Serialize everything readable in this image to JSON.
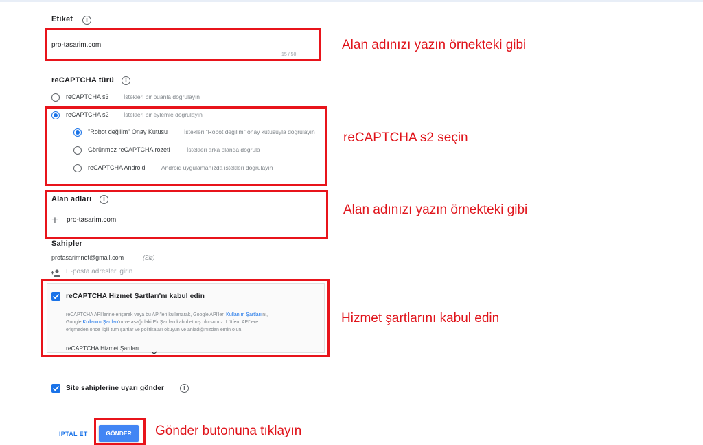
{
  "label_section": {
    "title": "Etiket",
    "value": "pro-tasarim.com",
    "counter": "15 / 50"
  },
  "recaptcha_type": {
    "title": "reCAPTCHA türü",
    "options": [
      {
        "label": "reCAPTCHA s3",
        "hint": "İstekleri bir puanla doğrulayın"
      },
      {
        "label": "reCAPTCHA s2",
        "hint": "İstekleri bir eylemle doğrulayın"
      }
    ],
    "sub_options": [
      {
        "label": "\"Robot değilim\" Onay Kutusu",
        "hint": "İstekleri \"Robot değilim\" onay kutusuyla doğrulayın"
      },
      {
        "label": "Görünmez reCAPTCHA rozeti",
        "hint": "İstekleri arka planda doğrula"
      },
      {
        "label": "reCAPTCHA Android",
        "hint": "Android uygulamanızda istekleri doğrulayın"
      }
    ]
  },
  "domains": {
    "title": "Alan adları",
    "value": "pro-tasarim.com"
  },
  "owners": {
    "title": "Sahipler",
    "email": "protasarimnet@gmail.com",
    "you_tag": "(Siz)",
    "placeholder": "E-posta adresleri girin"
  },
  "terms": {
    "title": "reCAPTCHA Hizmet Şartları'nı kabul edin",
    "body_1": "reCAPTCHA API'lerine erişerek veya bu API'leri kullanarak, Google API'leri ",
    "link_1": "Kullanım Şartları",
    "body_2": "'nı,",
    "body_3": "Google ",
    "link_2": "Kullanım Şartları",
    "body_4": "'nı ve aşağıdaki Ek Şartları kabul etmiş olursunuz. Lütfen, API'lere",
    "body_5": "erişmeden önce ilgili tüm şartlar ve politikaları okuyun ve anladığınızdan emin olun.",
    "dropdown": "reCAPTCHA Hizmet Şartları"
  },
  "alerts": {
    "label": "Site sahiplerine uyarı gönder"
  },
  "buttons": {
    "cancel": "İPTAL ET",
    "submit": "GÖNDER"
  },
  "annotations": {
    "a1": "Alan adınızı yazın örnekteki gibi",
    "a2": "reCAPTCHA s2 seçin",
    "a3": "Alan adınızı yazın örnekteki gibi",
    "a4": "Hizmet şartlarını kabul edin",
    "a5": "Gönder butonuna tıklayın"
  },
  "colors": {
    "accent": "#1a73e8",
    "annotation_red": "#e8141b",
    "submit_bg": "#4285f4"
  }
}
